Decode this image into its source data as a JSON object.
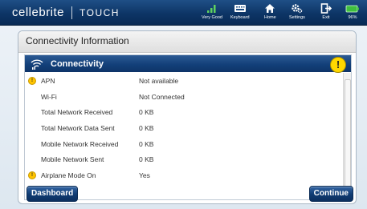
{
  "brand": {
    "name": "cellebrite",
    "product": "TOUCH"
  },
  "toolbar": {
    "signal_label": "Very Good",
    "keyboard_label": "Keyboard",
    "home_label": "Home",
    "settings_label": "Settings",
    "exit_label": "Exit",
    "battery_label": "96%"
  },
  "panel": {
    "title": "Connectivity Information"
  },
  "section": {
    "title": "Connectivity"
  },
  "rows": [
    {
      "label": "APN",
      "value": "Not available",
      "warning": true
    },
    {
      "label": "Wi-Fi",
      "value": "Not Connected",
      "warning": false
    },
    {
      "label": "Total Network Received",
      "value": "0 KB",
      "warning": false
    },
    {
      "label": "Total Network Data Sent",
      "value": "0 KB",
      "warning": false
    },
    {
      "label": "Mobile Network Received",
      "value": "0 KB",
      "warning": false
    },
    {
      "label": "Mobile Network Sent",
      "value": "0 KB",
      "warning": false
    },
    {
      "label": "Airplane Mode On",
      "value": "Yes",
      "warning": true
    }
  ],
  "buttons": {
    "back_label": "Dashboard",
    "next_label": "Continue"
  },
  "colors": {
    "accent": "#0f3b72",
    "warning": "#ffd800",
    "battery": "#3fbf3f"
  }
}
